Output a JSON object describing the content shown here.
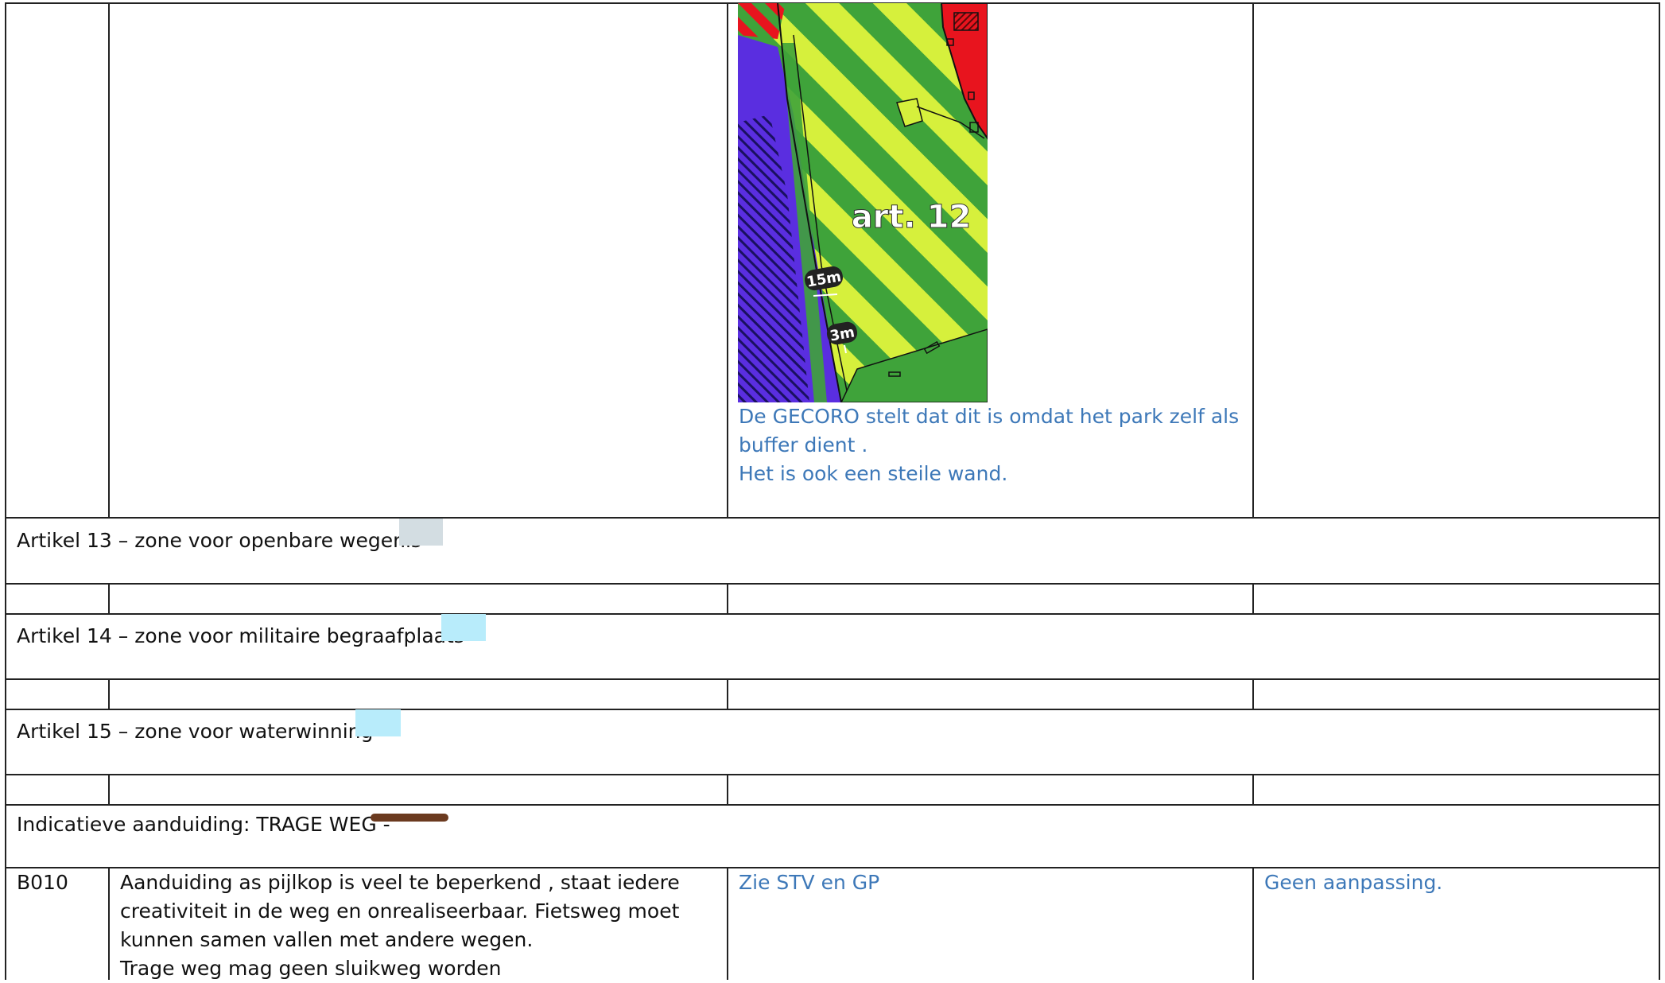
{
  "row1": {
    "map_label": "art. 12",
    "dim_15m": "15m",
    "dim_3m": "3m",
    "reaction_lines": [
      "De GECORO stelt dat dit is omdat het park zelf als",
      "buffer dient .",
      "Het is ook een steile wand."
    ]
  },
  "sections": [
    {
      "title": "Artikel 13 – zone voor openbare wegenis",
      "swatch_color": "#d3dde2"
    },
    {
      "title": "Artikel 14  – zone voor militaire begraafplaats",
      "swatch_color": "#b8ecfb"
    },
    {
      "title": "Artikel 15 – zone voor waterwinning",
      "swatch_color": "#b8ecfb"
    },
    {
      "title": "Indicatieve aanduiding: TRAGE WEG -",
      "swatch_color": "#6b3a1f"
    }
  ],
  "row_b010": {
    "id": "B010",
    "remark_lines": [
      "Aanduiding as pijlkop is veel te beperkend , staat iedere",
      "creativiteit in de weg en onrealiseerbaar. Fietsweg moet",
      "kunnen samen vallen met andere wegen.",
      "Trage weg mag geen sluikweg worden"
    ],
    "reaction": "Zie STV en GP",
    "decision": "Geen aanpassing."
  },
  "colors": {
    "reaction_text": "#3d78b8",
    "map_green": "#3fa33a",
    "map_yellow_green": "#d6f03c",
    "map_purple": "#5a2ee0",
    "map_red": "#e8141e"
  }
}
